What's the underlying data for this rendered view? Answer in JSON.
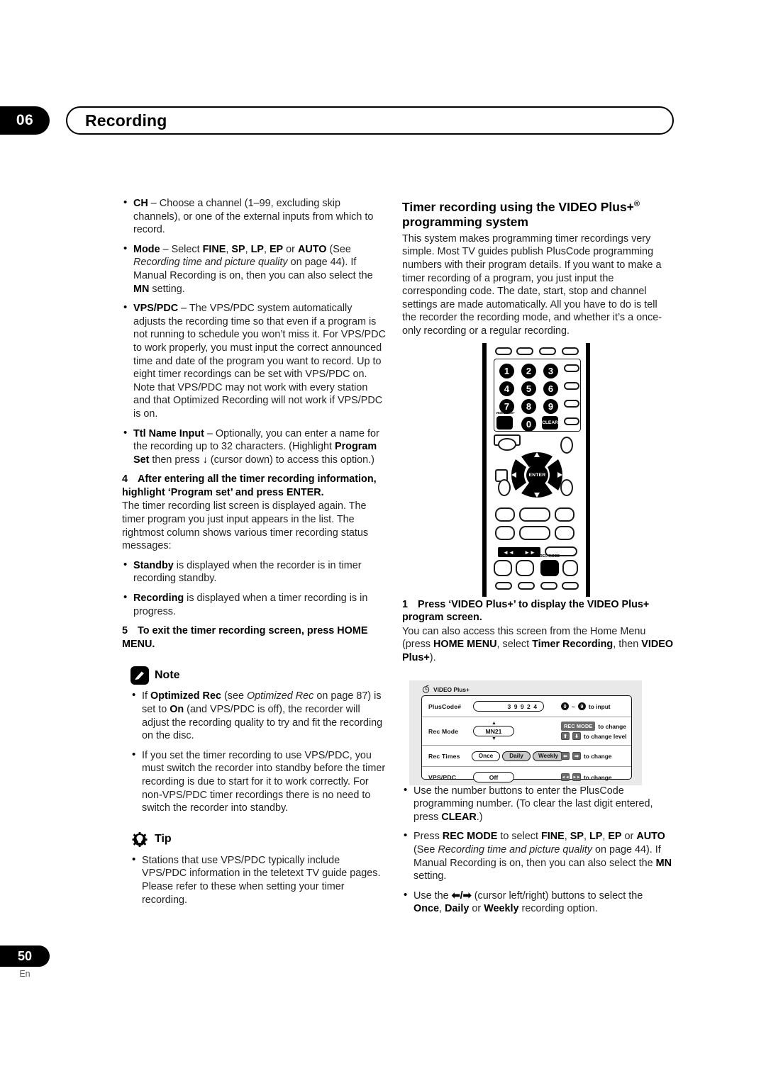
{
  "header": {
    "chapter_number": "06",
    "chapter_title": "Recording"
  },
  "footer": {
    "page_number": "50",
    "language": "En"
  },
  "left_column": {
    "bullets_top": [
      {
        "term": "CH",
        "text": " – Choose a channel (1–99, excluding skip channels), or one of the external inputs from which to record."
      }
    ],
    "mode_bullet": {
      "term": "Mode",
      "t1": " – Select ",
      "b1": "FINE",
      "t2": ", ",
      "b2": "SP",
      "t3": ", ",
      "b3": "LP",
      "t4": ", ",
      "b4": "EP",
      "t5": " or ",
      "b5": "AUTO",
      "t6": " (See ",
      "i1": "Recording time and picture quality",
      "t7": " on page 44). If Manual Recording is on, then you can also select the ",
      "b6": "MN",
      "t8": " setting."
    },
    "vps_bullet": {
      "term": "VPS/PDC",
      "text": " – The VPS/PDC system automatically adjusts the recording time so that even if a program is not running to schedule you won’t miss it. For VPS/PDC to work properly, you must input the correct announced time and date of the program you want to record. Up to eight timer recordings can be set with VPS/PDC on.",
      "text2": "Note that VPS/PDC may not work with every station and that Optimized Recording will not work if VPS/PDC is on."
    },
    "ttl_bullet": {
      "term": "Ttl Name Input",
      "t1": " – Optionally, you can enter a name for the recording up to 32 characters. (Highlight ",
      "b1": "Program Set",
      "t2": " then press ",
      "arrow": "↓",
      "t3": " (cursor down) to access this option.)"
    },
    "step4": {
      "number": "4",
      "heading": "After entering all the timer recording information, highlight ‘Program set’ and press ENTER.",
      "body": "The timer recording list screen is displayed again. The timer program you just input appears in the list. The rightmost column shows various timer recording status messages:"
    },
    "status_bullets": [
      {
        "term": "Standby",
        "text": " is displayed when the recorder is in timer recording standby."
      },
      {
        "term": "Recording",
        "text": " is displayed when a timer recording is in progress."
      }
    ],
    "step5": {
      "number": "5",
      "heading": "To exit the timer recording screen, press HOME MENU."
    },
    "note": {
      "label": "Note",
      "icon": "pencil-icon",
      "bullets": [
        {
          "t1": "If ",
          "b1": "Optimized Rec",
          "t2": " (see ",
          "i1": "Optimized Rec",
          "t3": " on page 87) is set to ",
          "b2": "On",
          "t4": " (and VPS/PDC is off), the recorder will adjust the recording quality to try and fit the recording on the disc."
        },
        {
          "t1": "If you set the timer recording to use VPS/PDC, you must switch the recorder into standby before the timer recording is due to start for it to work correctly. For non-VPS/PDC timer recordings there is no need to switch the recorder into standby."
        }
      ]
    },
    "tip": {
      "label": "Tip",
      "icon": "lightbulb-icon",
      "bullets": [
        {
          "t1": "Stations that use VPS/PDC typically include VPS/PDC information in the teletext TV guide pages. Please refer to these when setting your timer recording."
        }
      ]
    }
  },
  "right_column": {
    "section": {
      "title_line1_a": "Timer recording using the VIDEO Plus+",
      "title_reg": "®",
      "title_line2": "programming system",
      "body": "This system makes programming timer recordings very simple. Most TV guides publish PlusCode programming numbers with their program details. If you want to make a timer recording of a program, you just input the corresponding code. The date, start, stop and channel settings are made automatically. All you have to do is tell the recorder the recording mode, and whether it’s a once-only recording or a regular recording."
    },
    "step1": {
      "number": "1",
      "heading": "Press ‘VIDEO Plus+’ to display the VIDEO Plus+ program screen.",
      "body_t1": "You can also access this screen from the Home Menu (press ",
      "body_b1": "HOME MENU",
      "body_t2": ", select ",
      "body_b2": "Timer Recording",
      "body_t3": ", then ",
      "body_b3": "VIDEO Plus+",
      "body_t4": ")."
    },
    "bullets": [
      {
        "t1": "Use the number buttons to enter the PlusCode programming number. (To clear the last digit entered, press ",
        "b1": "CLEAR",
        "t2": ".)"
      },
      {
        "t1": "Press ",
        "b1": "REC MODE",
        "t2": " to select ",
        "b2": "FINE",
        "t3": ", ",
        "b3": "SP",
        "t4": ", ",
        "b4": "LP",
        "t5": ", ",
        "b5": "EP",
        "t6": " or ",
        "b6": "AUTO",
        "t7": " (See ",
        "i1": "Recording time and picture quality",
        "t8": " on page 44). If Manual Recording is on, then you can also select the ",
        "b7": "MN",
        "t9": " setting."
      },
      {
        "t1": "Use the ",
        "arrows": "⬅/➡",
        "t2": " (cursor left/right) buttons to select the ",
        "b1": "Once",
        "t3": ", ",
        "b2": "Daily",
        "t4": " or ",
        "b3": "Weekly",
        "t5": " recording option."
      }
    ]
  },
  "remote": {
    "name": "remote-control-illustration",
    "number_keys": [
      "1",
      "2",
      "3",
      "4",
      "5",
      "6",
      "7",
      "8",
      "9",
      "0"
    ],
    "video_plus_label": "VIDEO Plus+",
    "clear_label": "CLEAR",
    "enter_label": "ENTER",
    "rec_mode_label": "REC MODE",
    "skip_back": "◄◄",
    "skip_fwd": "►►",
    "dpad_up": "✦",
    "dpad_down": "✦",
    "dpad_left": "←",
    "dpad_right": "→"
  },
  "osd": {
    "title": "VIDEO Plus+",
    "rows": [
      {
        "label": "PlusCode#",
        "value": "3 9 9 2 4",
        "hint_text": "to input",
        "hint_from": "0",
        "hint_tilde": "~",
        "hint_to": "9"
      },
      {
        "label": "Rec  Mode",
        "value": "MN21",
        "hint1_key": "REC MODE",
        "hint1_text": "to change",
        "hint2_up": "⬆",
        "hint2_down": "⬇",
        "hint2_text": "to change level"
      },
      {
        "label": "Rec  Times",
        "options": [
          "Once",
          "Daily",
          "Weekly"
        ],
        "selected_options": [
          "Daily",
          "Weekly"
        ],
        "hint_left": "⬅",
        "hint_right": "➡",
        "hint_text": "to change"
      },
      {
        "label": "VPS/PDC",
        "value": "Off",
        "hint_left": "◄◄",
        "hint_right": "►►",
        "hint_text": "to change"
      }
    ]
  }
}
